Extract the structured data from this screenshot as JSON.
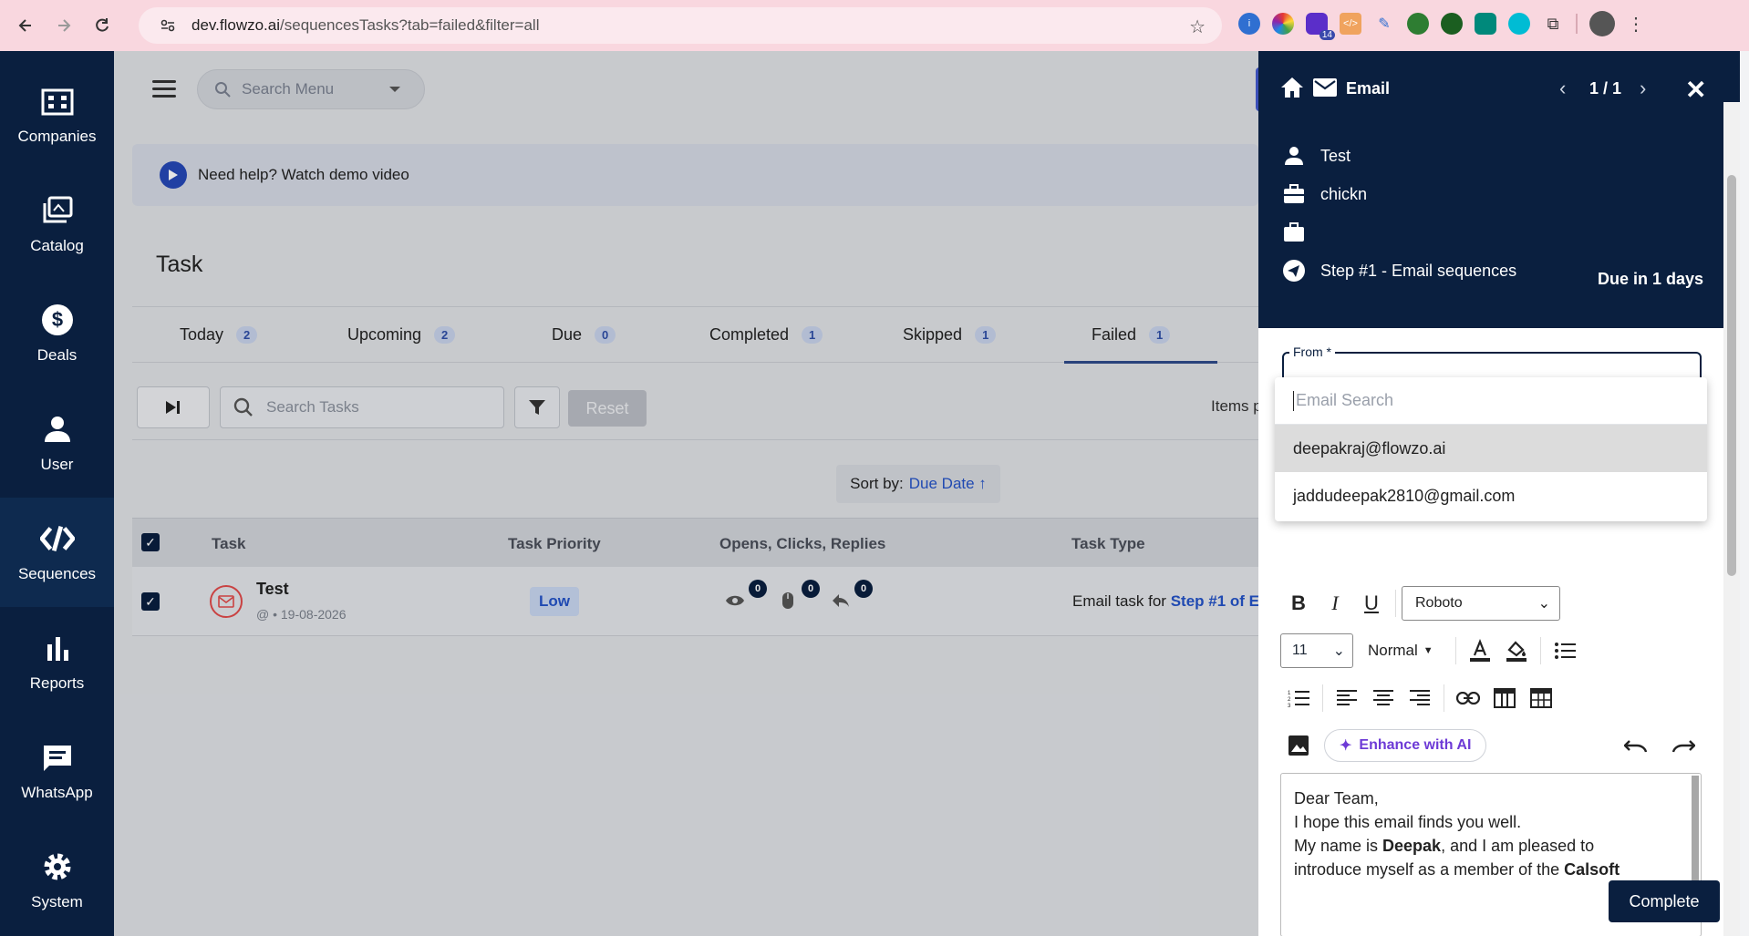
{
  "browser": {
    "url_host": "dev.flowzo.ai",
    "url_path": "/sequencesTasks?tab=failed&filter=all",
    "ext_badge": "14"
  },
  "sidebar": {
    "items": [
      {
        "label": "Companies",
        "icon": "building-icon"
      },
      {
        "label": "Catalog",
        "icon": "catalog-icon"
      },
      {
        "label": "Deals",
        "icon": "dollar-icon"
      },
      {
        "label": "User",
        "icon": "user-icon"
      },
      {
        "label": "Sequences",
        "icon": "sequences-icon"
      },
      {
        "label": "Reports",
        "icon": "bar-chart-icon"
      },
      {
        "label": "WhatsApp",
        "icon": "chat-icon"
      },
      {
        "label": "System",
        "icon": "gear-icon"
      }
    ]
  },
  "main": {
    "menu_search_placeholder": "Search Menu",
    "help_text": "Need help? Watch demo video",
    "title": "Task",
    "tabs": [
      {
        "label": "Today",
        "count": "2"
      },
      {
        "label": "Upcoming",
        "count": "2"
      },
      {
        "label": "Due",
        "count": "0"
      },
      {
        "label": "Completed",
        "count": "1"
      },
      {
        "label": "Skipped",
        "count": "1"
      },
      {
        "label": "Failed",
        "count": "1"
      }
    ],
    "task_search_placeholder": "Search Tasks",
    "reset_label": "Reset",
    "items_per_label": "Items p",
    "sort_label": "Sort by:",
    "sort_value": "Due Date ↑",
    "table": {
      "headers": [
        "Task",
        "Task Priority",
        "Opens, Clicks, Replies",
        "Task Type"
      ],
      "row": {
        "name": "Test",
        "meta": "@ • 19-08-2026",
        "priority": "Low",
        "opens": "0",
        "clicks": "0",
        "replies": "0",
        "type_prefix": "Email task for ",
        "type_link": "Step #1 of E"
      }
    }
  },
  "panel": {
    "title": "Email",
    "pager": "1 / 1",
    "contact_name": "Test",
    "company": "chickn",
    "job": "",
    "step": "Step #1 - Email sequences",
    "due": "Due in 1 days",
    "from_label": "From *",
    "email_search_placeholder": "Email Search",
    "email_options": [
      "deepakraj@flowzo.ai",
      "jaddudeepak2810@gmail.com"
    ],
    "font": "Roboto",
    "size": "11",
    "block_style": "Normal",
    "enhance_label": "Enhance with AI",
    "body": {
      "line1": "Dear Team,",
      "line2": "I hope this email finds you well.",
      "line3a": "My name is ",
      "line3b": "Deepak",
      "line3c": ", and I am pleased to",
      "line4a": "introduce myself as a member of the ",
      "line4b": "Calsoft"
    },
    "complete_label": "Complete"
  }
}
